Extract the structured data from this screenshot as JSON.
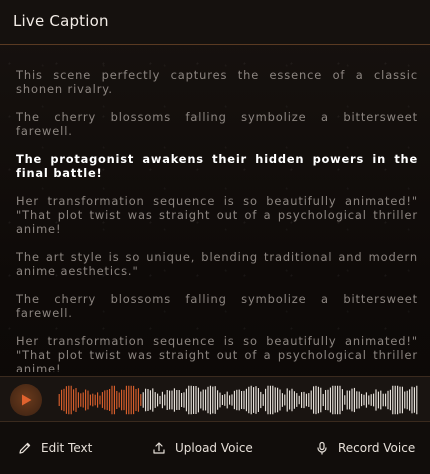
{
  "header": {
    "title": "Live Caption"
  },
  "transcript": {
    "paragraphs": [
      {
        "text": "This scene perfectly captures the essence of a classic shonen rivalry.",
        "active": false
      },
      {
        "text": "The cherry blossoms falling symbolize a bittersweet farewell.",
        "active": false
      },
      {
        "text": "The protagonist awakens their hidden powers in the final battle!",
        "active": true
      },
      {
        "text": "Her transformation sequence is so beautifully animated!\" \"That plot twist was straight out of a psychological thriller anime!",
        "active": false
      },
      {
        "text": "The art style is so unique, blending traditional and modern anime aesthetics.\"",
        "active": false
      },
      {
        "text": "The cherry blossoms falling symbolize a bittersweet farewell.",
        "active": false
      },
      {
        "text": "Her transformation sequence is so beautifully animated!\" \"That plot twist was straight out of a psychological thriller anime!",
        "active": false
      }
    ]
  },
  "player": {
    "play_icon": "play-icon",
    "progress": 0.23,
    "played_color": "#e0622e",
    "unplayed_color": "#f2ece6",
    "accent": "#e0622e"
  },
  "toolbar": {
    "edit_label": "Edit Text",
    "upload_label": "Upload Voice",
    "record_label": "Record Voice"
  }
}
